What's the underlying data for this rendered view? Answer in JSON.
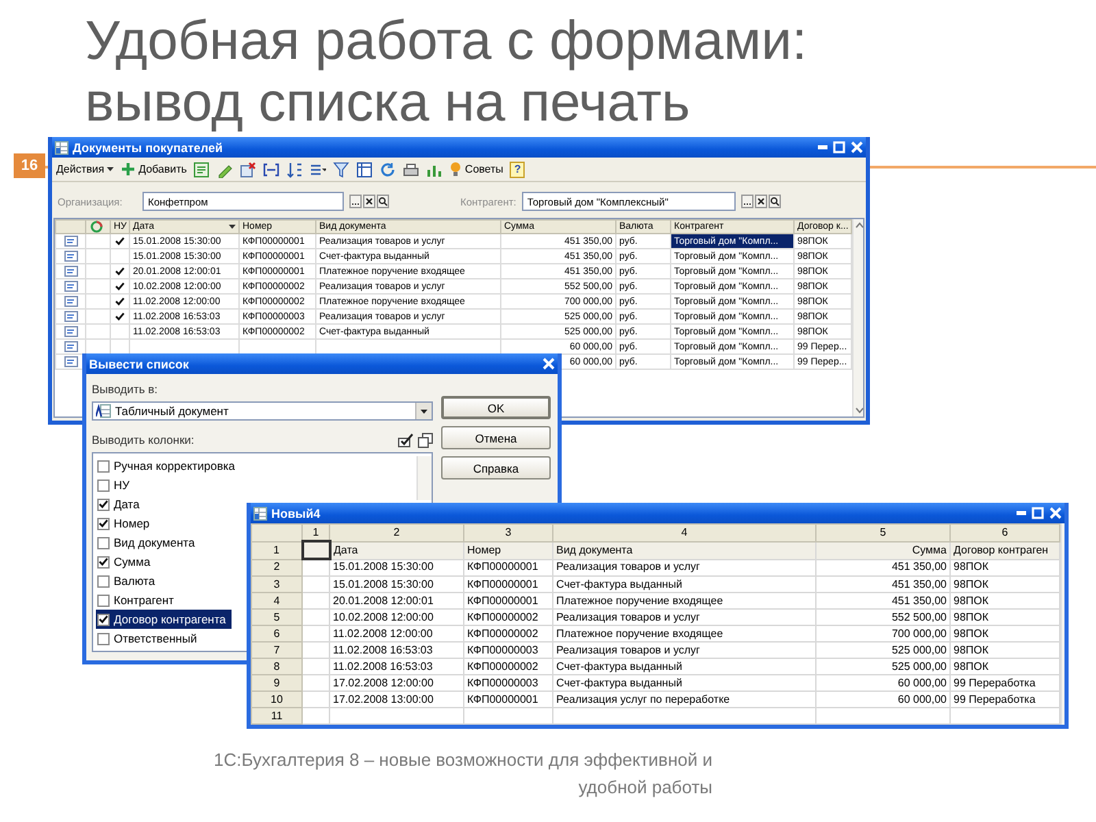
{
  "slide": {
    "title_lines": [
      "Удобная работа с формами:",
      "вывод списка на печать"
    ],
    "number": "16",
    "footer_lines": [
      "1С:Бухгалтерия 8 – новые возможности для эффективной и",
      "удобной работы"
    ]
  },
  "documents_window": {
    "title": "Документы покупателей",
    "actions_menu": "Действия",
    "add_button": "Добавить",
    "tips_button": "Советы",
    "help_button": "?",
    "filters": [
      {
        "label": "Организация:",
        "value": "Конфетпром"
      },
      {
        "label": "Контрагент:",
        "value": "Торговый дом \"Комплексный\""
      }
    ],
    "columns": [
      "НУ",
      "Дата",
      "Номер",
      "Вид документа",
      "Сумма",
      "Валюта",
      "Контрагент",
      "Договор к..."
    ],
    "rows": [
      {
        "nu": true,
        "date": "15.01.2008 15:30:00",
        "number": "КФП00000001",
        "type": "Реализация товаров и услуг",
        "sum": "451 350,00",
        "currency": "руб.",
        "contractor": "Торговый дом \"Компл...",
        "contract": "98ПОК",
        "selected": true
      },
      {
        "nu": false,
        "date": "15.01.2008 15:30:00",
        "number": "КФП00000001",
        "type": "Счет-фактура выданный",
        "sum": "451 350,00",
        "currency": "руб.",
        "contractor": "Торговый дом \"Компл...",
        "contract": "98ПОК",
        "selected": false
      },
      {
        "nu": true,
        "date": "20.01.2008 12:00:01",
        "number": "КФП00000001",
        "type": "Платежное поручение входящее",
        "sum": "451 350,00",
        "currency": "руб.",
        "contractor": "Торговый дом \"Компл...",
        "contract": "98ПОК",
        "selected": false
      },
      {
        "nu": true,
        "date": "10.02.2008 12:00:00",
        "number": "КФП00000002",
        "type": "Реализация товаров и услуг",
        "sum": "552 500,00",
        "currency": "руб.",
        "contractor": "Торговый дом \"Компл...",
        "contract": "98ПОК",
        "selected": false
      },
      {
        "nu": true,
        "date": "11.02.2008 12:00:00",
        "number": "КФП00000002",
        "type": "Платежное поручение входящее",
        "sum": "700 000,00",
        "currency": "руб.",
        "contractor": "Торговый дом \"Компл...",
        "contract": "98ПОК",
        "selected": false
      },
      {
        "nu": true,
        "date": "11.02.2008 16:53:03",
        "number": "КФП00000003",
        "type": "Реализация товаров и услуг",
        "sum": "525 000,00",
        "currency": "руб.",
        "contractor": "Торговый дом \"Компл...",
        "contract": "98ПОК",
        "selected": false
      },
      {
        "nu": false,
        "date": "11.02.2008 16:53:03",
        "number": "КФП00000002",
        "type": "Счет-фактура выданный",
        "sum": "525 000,00",
        "currency": "руб.",
        "contractor": "Торговый дом \"Компл...",
        "contract": "98ПОК",
        "selected": false
      },
      {
        "sum": "60 000,00",
        "currency": "руб.",
        "contractor": "Торговый дом \"Компл...",
        "contract": "99 Перер...",
        "selected": false
      },
      {
        "sum": "60 000,00",
        "currency": "руб.",
        "contractor": "Торговый дом \"Компл...",
        "contract": "99 Перер...",
        "selected": false
      }
    ]
  },
  "dialog": {
    "title": "Вывести список",
    "output_label": "Выводить в:",
    "output_value": "Табличный документ",
    "columns_label": "Выводить колонки:",
    "columns": [
      {
        "label": "Ручная корректировка",
        "checked": false,
        "selected": false
      },
      {
        "label": "НУ",
        "checked": false,
        "selected": false
      },
      {
        "label": "Дата",
        "checked": true,
        "selected": false
      },
      {
        "label": "Номер",
        "checked": true,
        "selected": false
      },
      {
        "label": "Вид документа",
        "checked": false,
        "selected": false
      },
      {
        "label": "Сумма",
        "checked": true,
        "selected": false
      },
      {
        "label": "Валюта",
        "checked": false,
        "selected": false
      },
      {
        "label": "Контрагент",
        "checked": false,
        "selected": false
      },
      {
        "label": "Договор контрагента",
        "checked": true,
        "selected": true
      },
      {
        "label": "Ответственный",
        "checked": false,
        "selected": false
      }
    ],
    "buttons": [
      "OK",
      "Отмена",
      "Справка"
    ]
  },
  "spreadsheet": {
    "title": "Новый4",
    "column_headers": [
      "1",
      "2",
      "3",
      "4",
      "5",
      "6"
    ],
    "rows": [
      {
        "label": "1",
        "kind": "header",
        "cells": [
          "Дата",
          "Номер",
          "Вид документа",
          "Сумма",
          "Договор контраген"
        ]
      },
      {
        "label": "2",
        "kind": "data",
        "cells": [
          "15.01.2008 15:30:00",
          "КФП00000001",
          "Реализация товаров и услуг",
          "451 350,00",
          "98ПОК"
        ]
      },
      {
        "label": "3",
        "kind": "data",
        "cells": [
          "15.01.2008 15:30:00",
          "КФП00000001",
          "Счет-фактура выданный",
          "451 350,00",
          "98ПОК"
        ]
      },
      {
        "label": "4",
        "kind": "data",
        "cells": [
          "20.01.2008 12:00:01",
          "КФП00000001",
          "Платежное поручение входящее",
          "451 350,00",
          "98ПОК"
        ]
      },
      {
        "label": "5",
        "kind": "data",
        "cells": [
          "10.02.2008 12:00:00",
          "КФП00000002",
          "Реализация товаров и услуг",
          "552 500,00",
          "98ПОК"
        ]
      },
      {
        "label": "6",
        "kind": "data",
        "cells": [
          "11.02.2008 12:00:00",
          "КФП00000002",
          "Платежное поручение входящее",
          "700 000,00",
          "98ПОК"
        ]
      },
      {
        "label": "7",
        "kind": "data",
        "cells": [
          "11.02.2008 16:53:03",
          "КФП00000003",
          "Реализация товаров и услуг",
          "525 000,00",
          "98ПОК"
        ]
      },
      {
        "label": "8",
        "kind": "data",
        "cells": [
          "11.02.2008 16:53:03",
          "КФП00000002",
          "Счет-фактура выданный",
          "525 000,00",
          "98ПОК"
        ]
      },
      {
        "label": "9",
        "kind": "data",
        "cells": [
          "17.02.2008 12:00:00",
          "КФП00000003",
          "Счет-фактура выданный",
          "60 000,00",
          "99 Переработка"
        ]
      },
      {
        "label": "10",
        "kind": "data",
        "cells": [
          "17.02.2008 13:00:00",
          "КФП00000001",
          "Реализация услуг по переработке",
          "60 000,00",
          "99 Переработка"
        ]
      },
      {
        "label": "11",
        "kind": "data"
      }
    ]
  }
}
